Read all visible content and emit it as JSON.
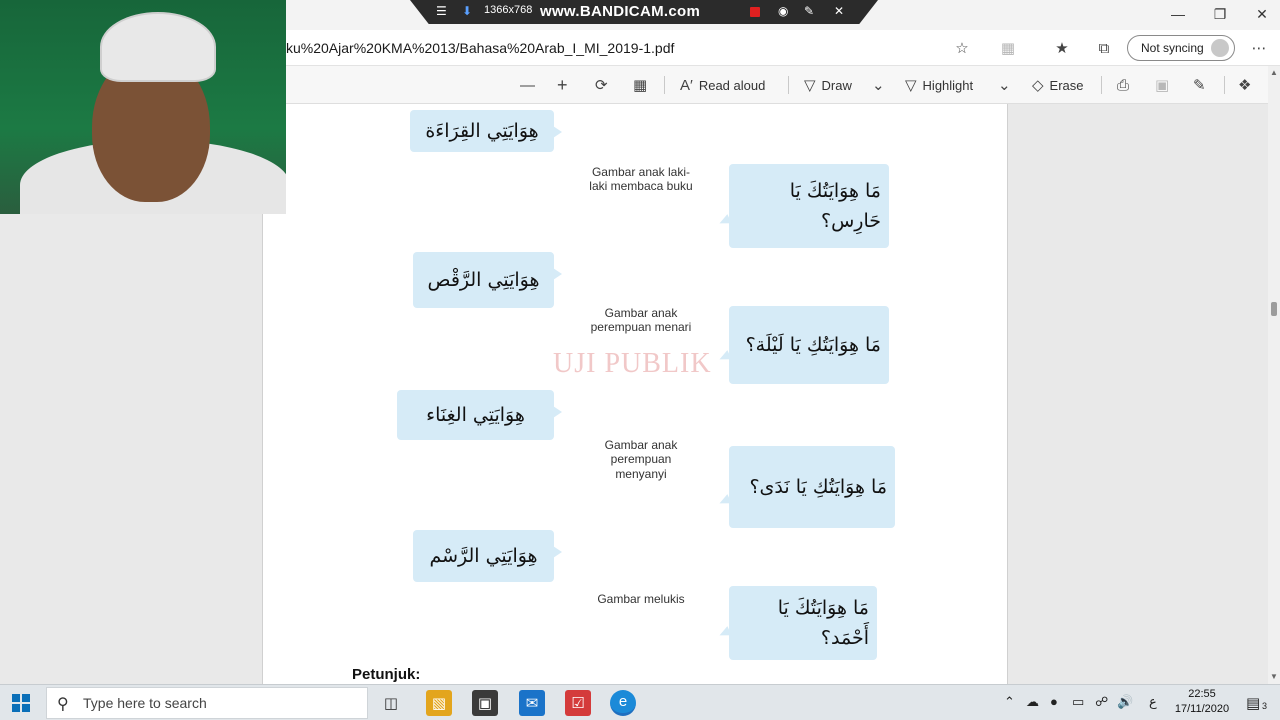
{
  "browser": {
    "url": "ku%20Ajar%20KMA%2013/Bahasa%20Arab_I_MI_2019-1.pdf",
    "sync_label": "Not syncing",
    "window_controls": [
      "minimize-icon",
      "restore-icon",
      "close-icon"
    ]
  },
  "recorder": {
    "resolution": "1366x768",
    "brand": "www.BANDICAM.com"
  },
  "pdf_toolbar": {
    "read_aloud": "Read aloud",
    "draw": "Draw",
    "highlight": "Highlight",
    "erase": "Erase"
  },
  "page": {
    "watermark": "UJI PUBLIK",
    "answers": [
      "هِوَايَتِي القِرَاءَة",
      "هِوَايَتِي الرَّقْص",
      "هِوَايَتِي الغِنَاء",
      "هِوَايَتِي الرَّسْم"
    ],
    "captions": [
      "Gambar anak laki-\nlaki membaca buku",
      "Gambar anak\nperempuan menari",
      "Gambar anak\nperempuan\nmenyanyi",
      "Gambar melukis"
    ],
    "questions": [
      "مَا هِوَايَتُكَ يَا\nحَارِس؟",
      "مَا هِوَايَتُكِ يَا لَيْلَة؟",
      "مَا هِوَايَتُكِ يَا نَدَى؟",
      "مَا هِوَايَتُكَ يَا\nأَحْمَد؟"
    ],
    "petunjuk": "Petunjuk:"
  },
  "taskbar": {
    "search_placeholder": "Type here to search",
    "ime": "ع",
    "time": "22:55",
    "date": "17/11/2020",
    "notifications": "3"
  }
}
